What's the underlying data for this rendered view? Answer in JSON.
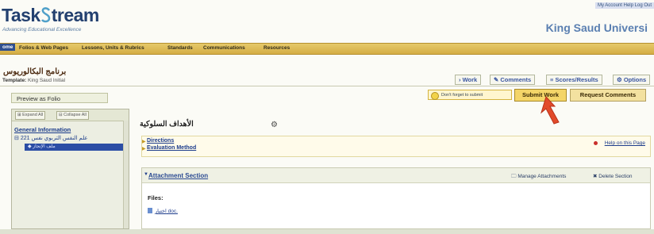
{
  "header": {
    "logo_prefix": "Task",
    "logo_suffix": "tream",
    "tagline": "Advancing Educational Excellence",
    "top_links": "My Account   Help   Log Out",
    "university": "King Saud Universi"
  },
  "nav": {
    "items": [
      "ome",
      "Folios & Web Pages",
      "Lessons, Units & Rubrics",
      "Standards",
      "Communications",
      "Resources"
    ]
  },
  "work": {
    "title_arabic": "برنامج البكالوريوس",
    "template_label": "Template:",
    "template_value": "King Saud Initial",
    "tabs": [
      "Work",
      "Comments",
      "Scores/Results",
      "Options"
    ]
  },
  "actions": {
    "preview": "Preview as Folio",
    "hint": "Don't forget to submit",
    "submit": "Submit Work",
    "request": "Request Comments"
  },
  "sidebar": {
    "expand_all": "Expand All",
    "collapse_all": "Collapse All",
    "general_info": "General Information",
    "course_item": "221 علم النفس التربوي نفس",
    "selected_item": "ملف الإنجاز"
  },
  "main": {
    "section_title": "الأهداف السلوكية",
    "directions": "Directions",
    "evaluation": "Evaluation Method",
    "help": "Help on this Page",
    "attachment_title": "Attachment Section",
    "manage": "Manage Attachments",
    "delete": "Delete Section",
    "files_label": "Files:",
    "file_name": "اختبار doc."
  },
  "colors": {
    "nav_gold": "#d4ad45",
    "brand_blue": "#23406f",
    "submit_yellow": "#f4d568",
    "selected_blue": "#2b4da5",
    "pointer_arrow": "#e24a2a"
  },
  "icons": [
    "bulb-icon",
    "gear-icon",
    "arrow-pointer-icon",
    "file-icon",
    "help-icon"
  ]
}
